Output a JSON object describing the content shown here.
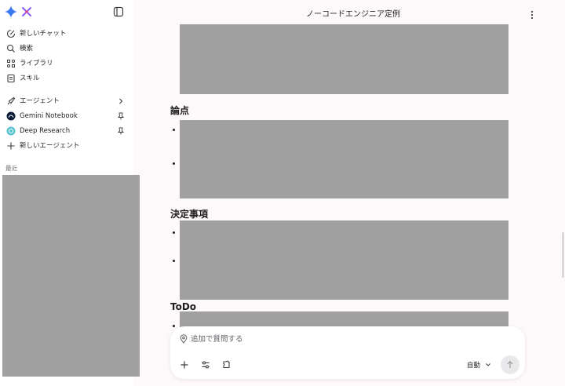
{
  "sidebar": {
    "items": [
      {
        "label": "新しいチャット",
        "icon": "new-chat-icon"
      },
      {
        "label": "検索",
        "icon": "search-icon"
      },
      {
        "label": "ライブラリ",
        "icon": "library-icon"
      },
      {
        "label": "スキル",
        "icon": "skill-icon"
      },
      {
        "label": "エージェント",
        "icon": "agent-rocket-icon"
      },
      {
        "label": "Gemini Notebook",
        "icon": "gemini-notebook-icon"
      },
      {
        "label": "Deep Research",
        "icon": "deep-research-icon"
      },
      {
        "label": "新しいエージェント",
        "icon": "plus-icon"
      }
    ],
    "recent_label": "最近"
  },
  "main": {
    "title": "ノーコードエンジニア定例",
    "sections": [
      {
        "heading": "論点"
      },
      {
        "heading": "決定事項"
      },
      {
        "heading": "ToDo"
      }
    ]
  },
  "composer": {
    "placeholder": "追加で質問する",
    "mode": "自動"
  },
  "colors": {
    "accent_blue": "#2f6bed",
    "redacted_gray": "#a0a0a0",
    "page_bg": "#fdf8fa"
  }
}
